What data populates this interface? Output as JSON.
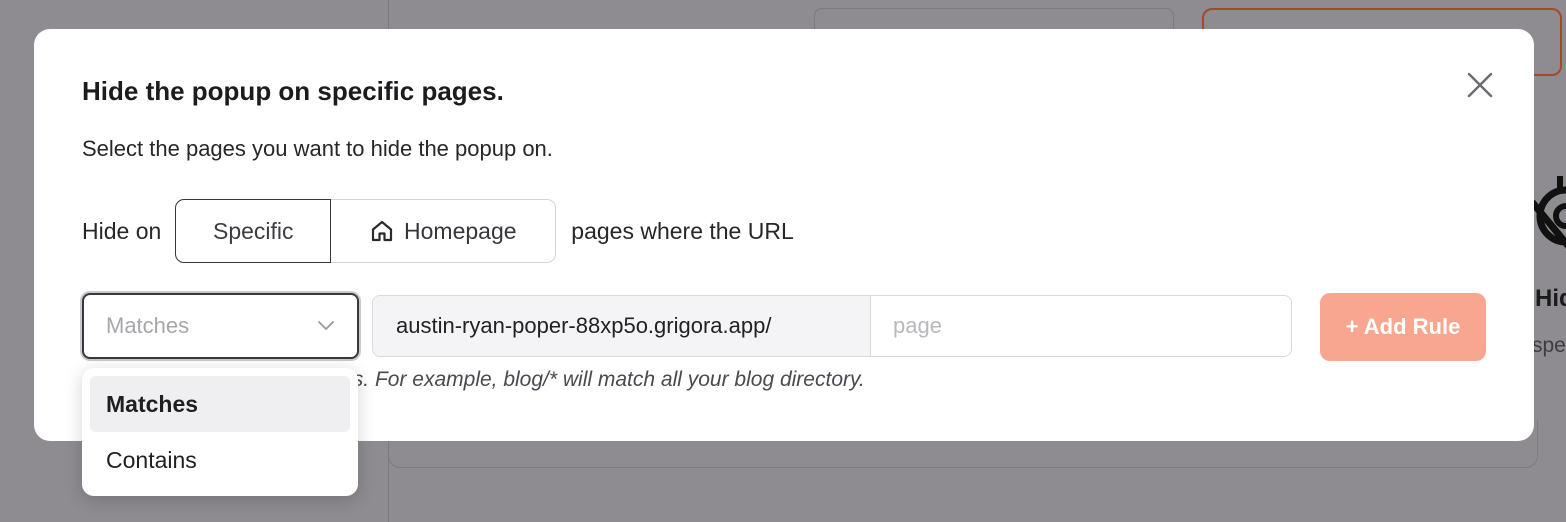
{
  "background": {
    "right_title": "Hid",
    "right_subtitle": "spe"
  },
  "modal": {
    "title": "Hide the popup on specific pages.",
    "description": "Select the pages you want to hide the popup on.",
    "close_icon": "close-icon",
    "hide_on_label": "Hide on",
    "segments": [
      {
        "label": "Specific",
        "selected": true
      },
      {
        "label": "Homepage",
        "icon": "home-icon",
        "selected": false
      }
    ],
    "url_label": "pages where the URL",
    "rule": {
      "match_type": "Matches",
      "match_placeholder": "Matches",
      "url_prefix": "austin-ryan-poper-88xp5o.grigora.app/",
      "path_placeholder": "page",
      "add_rule_label": "+ Add Rule"
    },
    "help_text": "racters. For example, blog/* will match all your blog directory."
  },
  "dropdown": {
    "options": [
      {
        "label": "Matches",
        "selected": true
      },
      {
        "label": "Contains",
        "selected": false
      }
    ]
  },
  "colors": {
    "overlay": "#8e8c91",
    "accent_disabled": "#f9a690"
  }
}
